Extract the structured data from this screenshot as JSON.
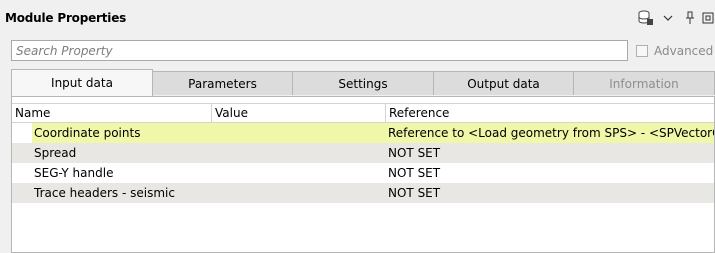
{
  "window": {
    "title": "Module Properties",
    "icons": [
      "database-lock-icon",
      "chevron-down-icon",
      "pin-icon",
      "float-window-icon"
    ]
  },
  "search": {
    "placeholder": "Search Property",
    "value": ""
  },
  "advanced": {
    "label": "Advanced",
    "checked": false
  },
  "tabs": [
    {
      "label": "Input data",
      "active": true
    },
    {
      "label": "Parameters"
    },
    {
      "label": "Settings"
    },
    {
      "label": "Output data"
    },
    {
      "label": "Information",
      "disabled": true
    }
  ],
  "table": {
    "columns": [
      "Name",
      "Value",
      "Reference"
    ],
    "rows": [
      {
        "name": "Coordinate points",
        "value": "",
        "reference": "Reference to <Load geometry from SPS> - <SPVectorOut>"
      },
      {
        "name": "Spread",
        "value": "",
        "reference": "NOT SET"
      },
      {
        "name": "SEG-Y handle",
        "value": "",
        "reference": "NOT SET"
      },
      {
        "name": "Trace headers - seismic",
        "value": "",
        "reference": "NOT SET"
      }
    ]
  },
  "colors": {
    "selected_row": "#f1f7a9",
    "alt_row": "#e9e7e3"
  }
}
